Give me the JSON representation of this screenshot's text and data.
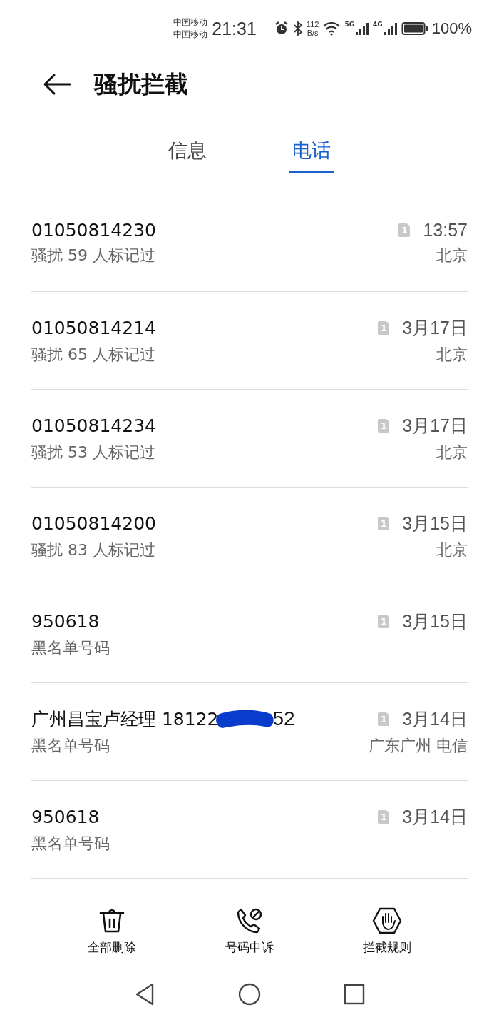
{
  "status_bar": {
    "carriers": [
      "中国移动",
      "中国移动"
    ],
    "time": "21:31",
    "speed": [
      "112",
      "B/s"
    ],
    "sim1_network": "5G",
    "sim2_network": "4G",
    "battery": "100%"
  },
  "header": {
    "title": "骚扰拦截"
  },
  "tabs": [
    {
      "label": "信息",
      "selected": false
    },
    {
      "label": "电话",
      "selected": true
    }
  ],
  "calls": [
    {
      "number": "01050814230",
      "note": "骚扰  59 人标记过",
      "sim": "1",
      "time": "13:57",
      "location": "北京"
    },
    {
      "number": "01050814214",
      "note": "骚扰  65 人标记过",
      "sim": "1",
      "time": "3月17日",
      "location": "北京"
    },
    {
      "number": "01050814234",
      "note": "骚扰  53 人标记过",
      "sim": "1",
      "time": "3月17日",
      "location": "北京"
    },
    {
      "number": "01050814200",
      "note": "骚扰  83 人标记过",
      "sim": "1",
      "time": "3月15日",
      "location": "北京"
    },
    {
      "number": "950618",
      "note": "黑名单号码",
      "sim": "1",
      "time": "3月15日"
    },
    {
      "number": "广州昌宝卢经理 18122",
      "number_tail": "52",
      "redacted": true,
      "note": "黑名单号码",
      "sim": "1",
      "time": "3月14日",
      "location": "广东广州 电信"
    },
    {
      "number": "950618",
      "note": "黑名单号码",
      "sim": "1",
      "time": "3月14日"
    }
  ],
  "actions": [
    {
      "kind": "delete",
      "label": "全部删除"
    },
    {
      "kind": "appeal",
      "label": "号码申诉"
    },
    {
      "kind": "rules",
      "label": "拦截规则"
    }
  ]
}
